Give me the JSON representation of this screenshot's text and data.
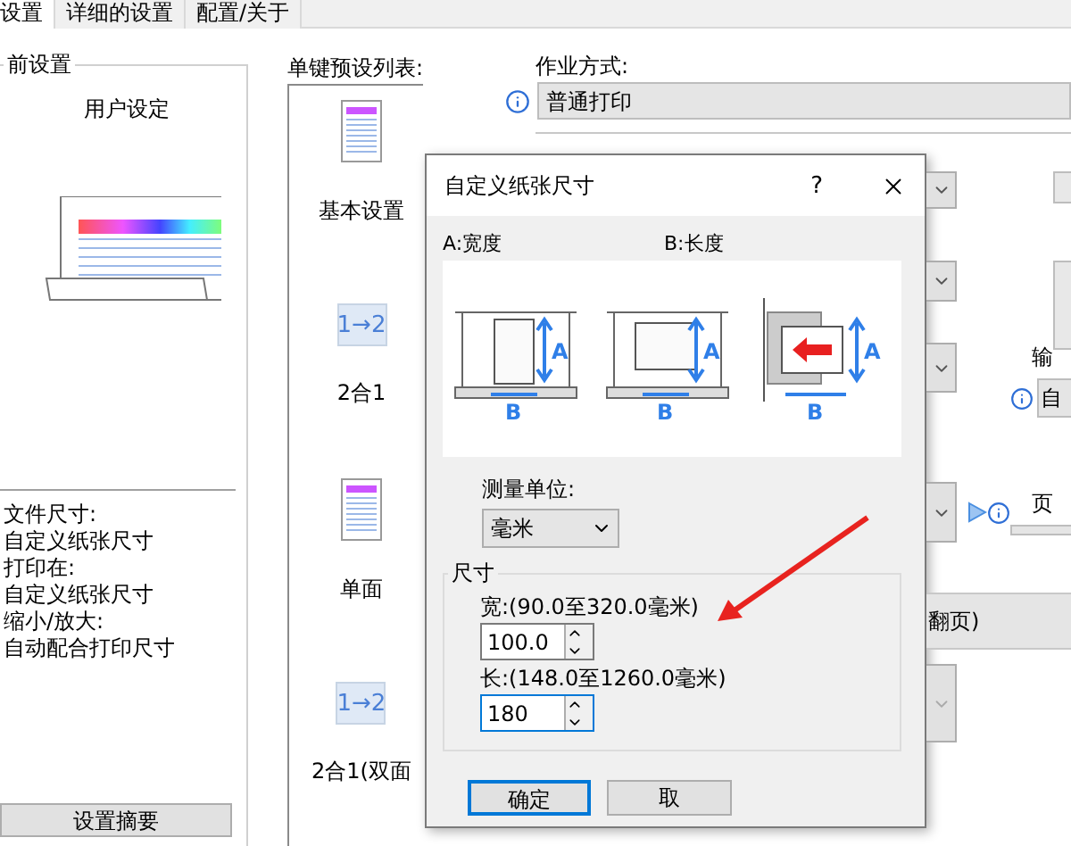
{
  "tabs": [
    {
      "label": "设置",
      "selected": true
    },
    {
      "label": "详细的设置",
      "selected": false
    },
    {
      "label": "配置/关于",
      "selected": false
    }
  ],
  "current_settings": {
    "title": "前设置",
    "profile": "用户设定",
    "summary": [
      "文件尺寸:",
      "自定义纸张尺寸",
      "打印在:",
      "自定义纸张尺寸",
      "缩小/放大:",
      "自动配合打印尺寸"
    ],
    "button": "设置摘要"
  },
  "preset_list": {
    "label": "单键预设列表:",
    "items": [
      {
        "kind": "page",
        "label": "基本设置"
      },
      {
        "kind": "two_up",
        "badge": "1→2",
        "label": "2合1"
      },
      {
        "kind": "page",
        "label": "单面"
      },
      {
        "kind": "two_up",
        "badge": "1→2",
        "label": "2合1(双面"
      }
    ]
  },
  "job": {
    "label": "作业方式:",
    "value": "普通打印"
  },
  "side": {
    "output_label": "输",
    "output_value": "自",
    "page_label": "页",
    "duplex_text": "翻页)"
  },
  "dialog": {
    "title": "自定义纸张尺寸",
    "help": "?",
    "a_label": "A:宽度",
    "b_label": "B:长度",
    "diagrams": [
      {
        "kind": "portrait",
        "a": "A",
        "b": "B"
      },
      {
        "kind": "landscape",
        "a": "A",
        "b": "B"
      },
      {
        "kind": "feed",
        "a": "A",
        "b": "B"
      }
    ],
    "unit": {
      "label": "测量单位:",
      "value": "毫米"
    },
    "size": {
      "title": "尺寸",
      "fields": [
        {
          "label": "宽:(90.0至320.0毫米)",
          "value": "100.0",
          "focused": false
        },
        {
          "label": "长:(148.0至1260.0毫米)",
          "value": "180",
          "focused": true
        }
      ]
    },
    "buttons": [
      {
        "label": "确定",
        "default": true
      },
      {
        "label": "取",
        "default": false
      }
    ]
  },
  "annotations": [
    {
      "kind": "arrow"
    }
  ]
}
